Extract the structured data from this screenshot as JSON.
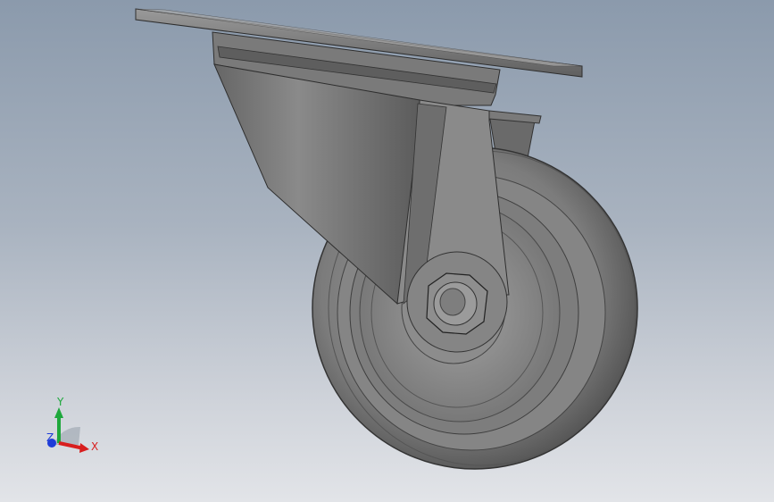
{
  "viewport": {
    "background_top": "#8b9aac",
    "background_bottom": "#e2e4e8",
    "model": "swivel-caster-wheel"
  },
  "triad": {
    "x_label": "X",
    "y_label": "Y",
    "z_label": "Z",
    "x_color": "#d81e1e",
    "y_color": "#1ea83c",
    "z_color": "#1e3cd8"
  }
}
